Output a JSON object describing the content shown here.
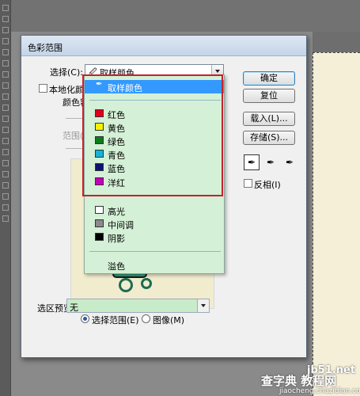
{
  "dialog": {
    "title": "色彩范围",
    "select_label": "选择(C):",
    "select_value": "取样颜色",
    "localized_label": "本地化颜",
    "color_label": "颜色容",
    "range_label": "范围(",
    "ok": "确定",
    "reset": "复位",
    "load": "载入(L)...",
    "save": "存储(S)...",
    "invert": "反相(I)",
    "radio_selection": "选择范围(E)",
    "radio_image": "图像(M)",
    "preview_label": "选区预览(T):",
    "preview_value": "无"
  },
  "menu": {
    "items": [
      {
        "label": "取样颜色",
        "swatch": null,
        "highlighted": true
      },
      {
        "label": "红色",
        "swatch": "#e0001a"
      },
      {
        "label": "黄色",
        "swatch": "#f5f200"
      },
      {
        "label": "绿色",
        "swatch": "#0b7d1c"
      },
      {
        "label": "青色",
        "swatch": "#12b5d6"
      },
      {
        "label": "蓝色",
        "swatch": "#0a1470"
      },
      {
        "label": "洋红",
        "swatch": "#c400b8"
      },
      {
        "label": "高光",
        "swatch": "#ffffff"
      },
      {
        "label": "中间调",
        "swatch": "#8a8a8a"
      },
      {
        "label": "阴影",
        "swatch": "#000000"
      },
      {
        "label": "溢色",
        "swatch": null
      }
    ]
  },
  "watermark": {
    "site": "jb51.net",
    "brand": "查字典 教程网",
    "url": "jiaocheng.chazidian.com"
  }
}
